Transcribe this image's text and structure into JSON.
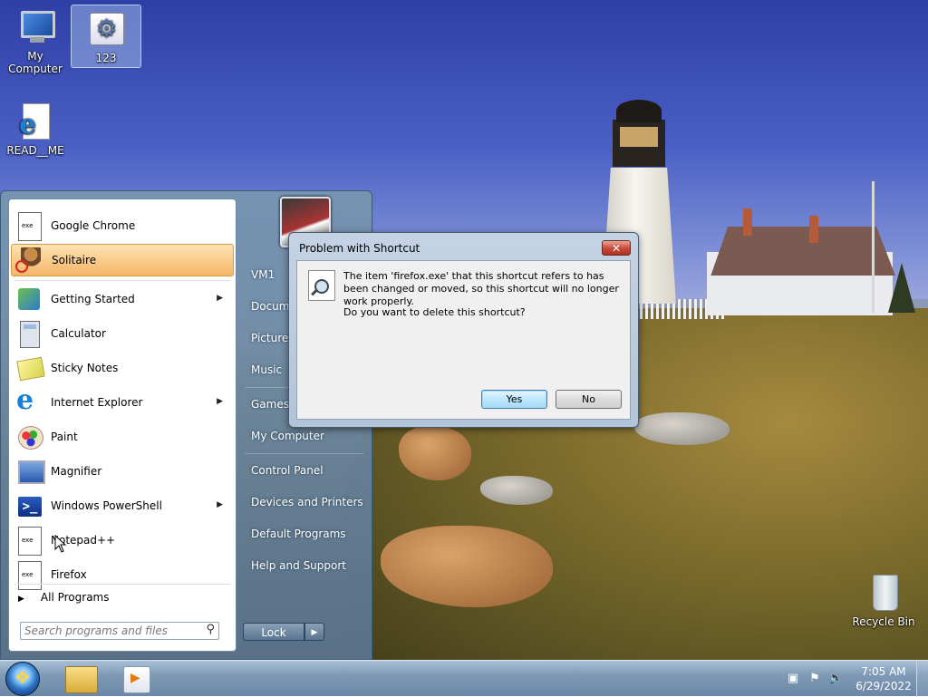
{
  "desktop_icons": {
    "my_computer": "My Computer",
    "shortcut_123": "123",
    "readme": "READ__ME",
    "recycle_bin": "Recycle Bin"
  },
  "start_menu": {
    "programs": [
      {
        "label": "Google Chrome",
        "icon": "exe-icon"
      },
      {
        "label": "Solitaire",
        "icon": "solitaire-icon"
      },
      {
        "label": "Getting Started",
        "icon": "getting-started-icon"
      },
      {
        "label": "Calculator",
        "icon": "calculator-icon"
      },
      {
        "label": "Sticky Notes",
        "icon": "sticky-notes-icon"
      },
      {
        "label": "Internet Explorer",
        "icon": "internet-explorer-icon"
      },
      {
        "label": "Paint",
        "icon": "paint-icon"
      },
      {
        "label": "Magnifier",
        "icon": "magnifier-icon"
      },
      {
        "label": "Windows PowerShell",
        "icon": "powershell-icon"
      },
      {
        "label": "Notepad++",
        "icon": "exe-icon"
      },
      {
        "label": "Firefox",
        "icon": "exe-icon"
      }
    ],
    "all_programs": "All Programs",
    "search_placeholder": "Search programs and files",
    "right_items": [
      "VM1",
      "Docume",
      "Pictures",
      "Music",
      "Games",
      "My Computer",
      "Control Panel",
      "Devices and Printers",
      "Default Programs",
      "Help and Support"
    ],
    "lock_label": "Lock",
    "lock_arrow": "▶"
  },
  "dialog": {
    "title": "Problem with Shortcut",
    "close": "✕",
    "message": "The item 'firefox.exe' that this shortcut refers to has been changed or moved, so this shortcut will no longer work properly.",
    "question": "Do you want to delete this shortcut?",
    "yes": "Yes",
    "no": "No"
  },
  "taskbar": {
    "time": "7:05 AM",
    "date": "6/29/2022"
  }
}
